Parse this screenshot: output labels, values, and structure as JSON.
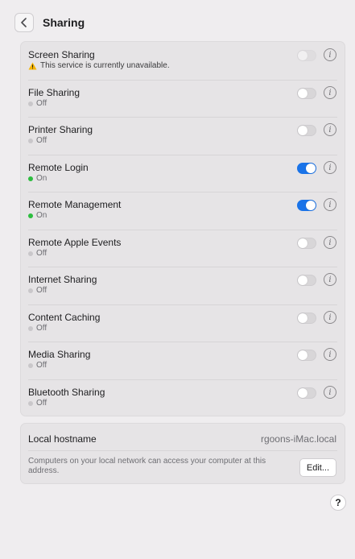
{
  "header": {
    "title": "Sharing"
  },
  "services": [
    {
      "name": "Screen Sharing",
      "status": "This service is currently unavailable.",
      "state": "unavailable"
    },
    {
      "name": "File Sharing",
      "status": "Off",
      "state": "off"
    },
    {
      "name": "Printer Sharing",
      "status": "Off",
      "state": "off"
    },
    {
      "name": "Remote Login",
      "status": "On",
      "state": "on"
    },
    {
      "name": "Remote Management",
      "status": "On",
      "state": "on"
    },
    {
      "name": "Remote Apple Events",
      "status": "Off",
      "state": "off"
    },
    {
      "name": "Internet Sharing",
      "status": "Off",
      "state": "off"
    },
    {
      "name": "Content Caching",
      "status": "Off",
      "state": "off"
    },
    {
      "name": "Media Sharing",
      "status": "Off",
      "state": "off"
    },
    {
      "name": "Bluetooth Sharing",
      "status": "Off",
      "state": "off"
    }
  ],
  "hostname": {
    "label": "Local hostname",
    "value": "rgoons-iMac.local",
    "description": "Computers on your local network can access your computer at this address.",
    "edit_label": "Edit..."
  },
  "help": {
    "label": "?"
  },
  "colors": {
    "accent": "#1a73e8",
    "on_dot": "#2dbd3f",
    "off_dot": "#c9c7ca",
    "warning": "#f5b400"
  }
}
